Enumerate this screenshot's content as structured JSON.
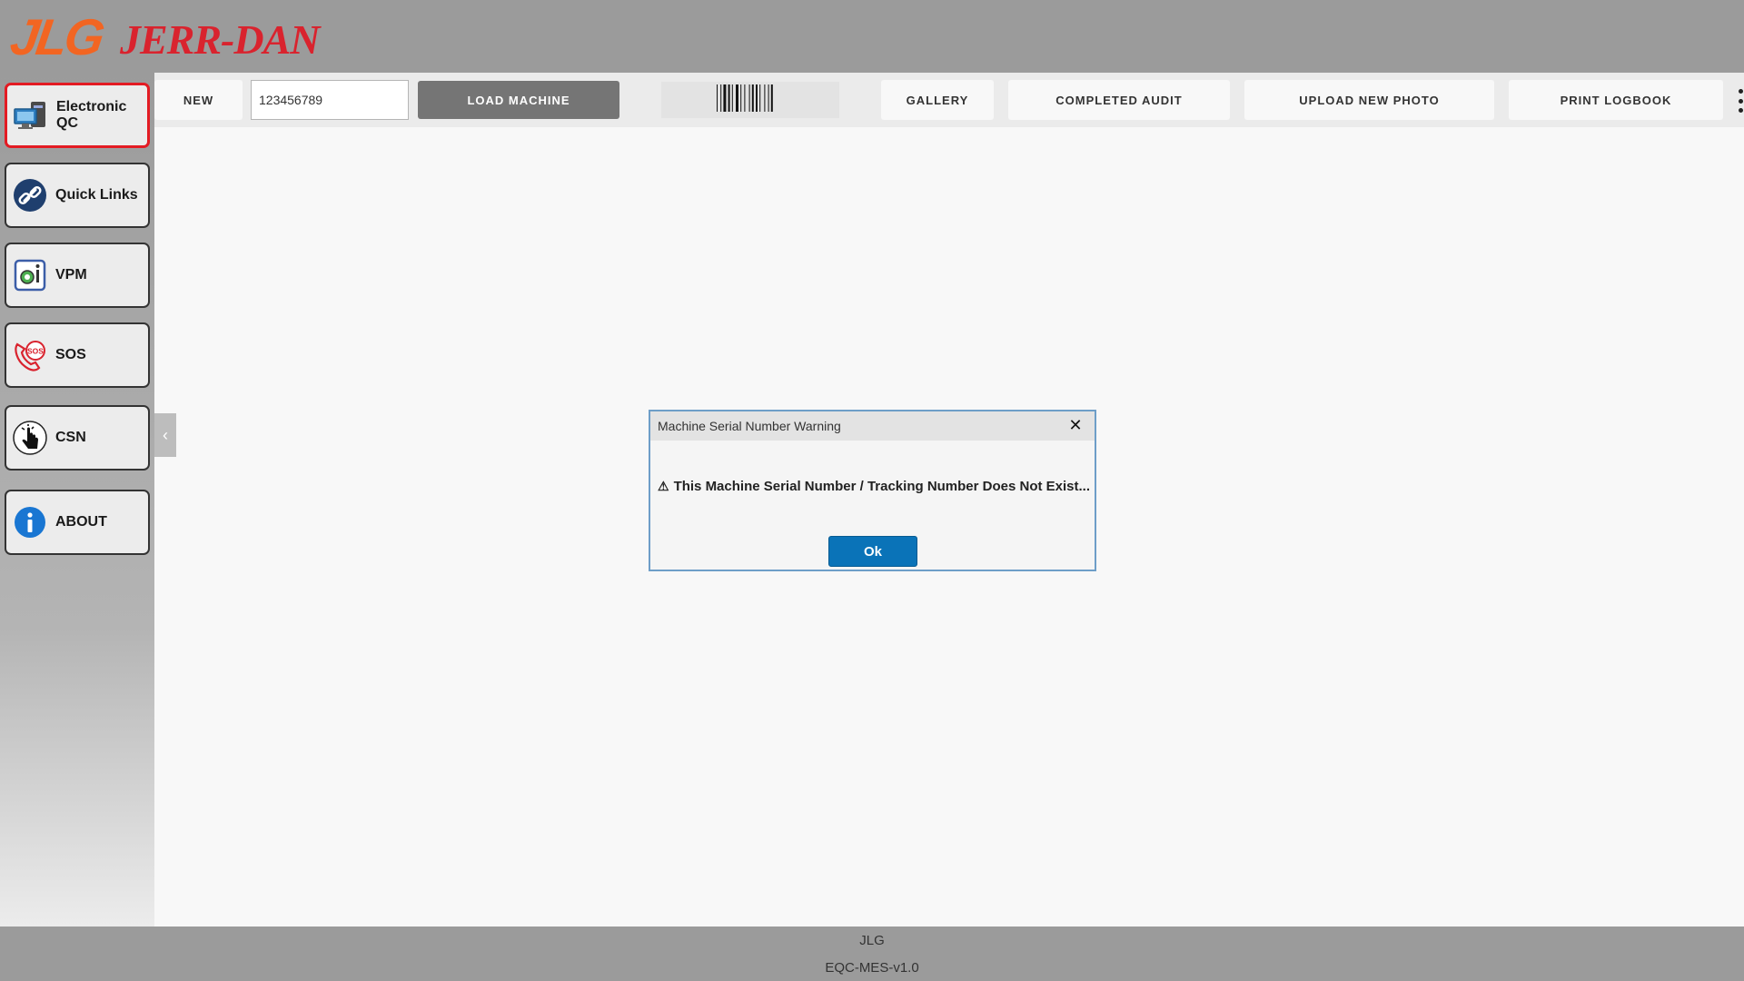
{
  "header": {
    "logo_primary": "JLG",
    "logo_secondary": "JERR-DAN",
    "logo_primary_color": "#f26522",
    "logo_secondary_color": "#d9232e"
  },
  "sidebar": {
    "items": [
      {
        "label": "Electronic QC",
        "icon": "monitor-icon",
        "active": true
      },
      {
        "label": "Quick Links",
        "icon": "link-icon"
      },
      {
        "label": "VPM",
        "icon": "vpm-icon"
      },
      {
        "label": "SOS",
        "icon": "sos-phone-icon"
      },
      {
        "label": "CSN",
        "icon": "hand-pointer-icon"
      },
      {
        "label": "ABOUT",
        "icon": "info-icon"
      }
    ]
  },
  "toolbar": {
    "new_label": "NEW",
    "serial_input_value": "123456789",
    "load_label": "LOAD MACHINE",
    "barcode_icon": "barcode-icon",
    "gallery_label": "GALLERY",
    "completed_audit_label": "COMPLETED AUDIT",
    "upload_photo_label": "UPLOAD NEW PHOTO",
    "print_logbook_label": "PRINT LOGBOOK",
    "more_icon": "kebab-menu-icon"
  },
  "dialog": {
    "title": "Machine Serial Number Warning",
    "warning_symbol": "⚠",
    "message": "This Machine Serial Number / Tracking Number Does Not Exist...",
    "ok_label": "Ok",
    "accent_color": "#0a73b8"
  },
  "footer": {
    "line1": "JLG",
    "line2": "EQC-MES-v1.0"
  }
}
